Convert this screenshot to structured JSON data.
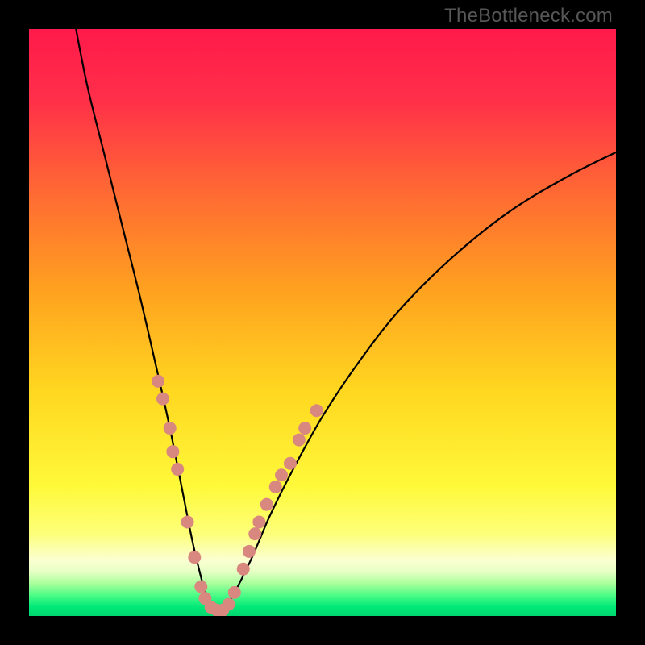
{
  "watermark": "TheBottleneck.com",
  "chart_data": {
    "type": "line",
    "title": "",
    "xlabel": "",
    "ylabel": "",
    "xlim": [
      0,
      100
    ],
    "ylim": [
      0,
      100
    ],
    "gradient_stops": [
      {
        "offset": 0.0,
        "color": "#ff1a4b"
      },
      {
        "offset": 0.12,
        "color": "#ff2f49"
      },
      {
        "offset": 0.28,
        "color": "#ff6a33"
      },
      {
        "offset": 0.45,
        "color": "#ffa31f"
      },
      {
        "offset": 0.62,
        "color": "#ffd820"
      },
      {
        "offset": 0.78,
        "color": "#fff93a"
      },
      {
        "offset": 0.86,
        "color": "#fdff7a"
      },
      {
        "offset": 0.905,
        "color": "#fbffd2"
      },
      {
        "offset": 0.925,
        "color": "#e6ffc4"
      },
      {
        "offset": 0.945,
        "color": "#a7ff9b"
      },
      {
        "offset": 0.965,
        "color": "#4bfc86"
      },
      {
        "offset": 0.985,
        "color": "#00e877"
      },
      {
        "offset": 1.0,
        "color": "#00d66e"
      }
    ],
    "series": [
      {
        "name": "bottleneck-curve",
        "x": [
          8,
          10,
          13,
          16,
          19,
          22,
          24,
          26,
          28,
          30,
          31,
          33,
          35,
          38,
          41,
          45,
          50,
          56,
          63,
          72,
          82,
          92,
          100
        ],
        "y": [
          100,
          90,
          78,
          66,
          54,
          41,
          32,
          22,
          12,
          4,
          1,
          1,
          4,
          10,
          17,
          25,
          34,
          43,
          52,
          61,
          69,
          75,
          79
        ]
      }
    ],
    "markers": {
      "color": "#d98880",
      "radius": 8,
      "points": [
        {
          "x": 22.0,
          "y": 40
        },
        {
          "x": 22.8,
          "y": 37
        },
        {
          "x": 24.0,
          "y": 32
        },
        {
          "x": 24.5,
          "y": 28
        },
        {
          "x": 25.3,
          "y": 25
        },
        {
          "x": 27.0,
          "y": 16
        },
        {
          "x": 28.2,
          "y": 10
        },
        {
          "x": 29.3,
          "y": 5
        },
        {
          "x": 30.0,
          "y": 3
        },
        {
          "x": 31.0,
          "y": 1.5
        },
        {
          "x": 32.0,
          "y": 1
        },
        {
          "x": 33.0,
          "y": 1
        },
        {
          "x": 34.0,
          "y": 2
        },
        {
          "x": 35.0,
          "y": 4
        },
        {
          "x": 36.5,
          "y": 8
        },
        {
          "x": 37.5,
          "y": 11
        },
        {
          "x": 38.5,
          "y": 14
        },
        {
          "x": 39.2,
          "y": 16
        },
        {
          "x": 40.5,
          "y": 19
        },
        {
          "x": 42.0,
          "y": 22
        },
        {
          "x": 43.0,
          "y": 24
        },
        {
          "x": 44.5,
          "y": 26
        },
        {
          "x": 46.0,
          "y": 30
        },
        {
          "x": 47.0,
          "y": 32
        },
        {
          "x": 49.0,
          "y": 35
        }
      ]
    }
  }
}
